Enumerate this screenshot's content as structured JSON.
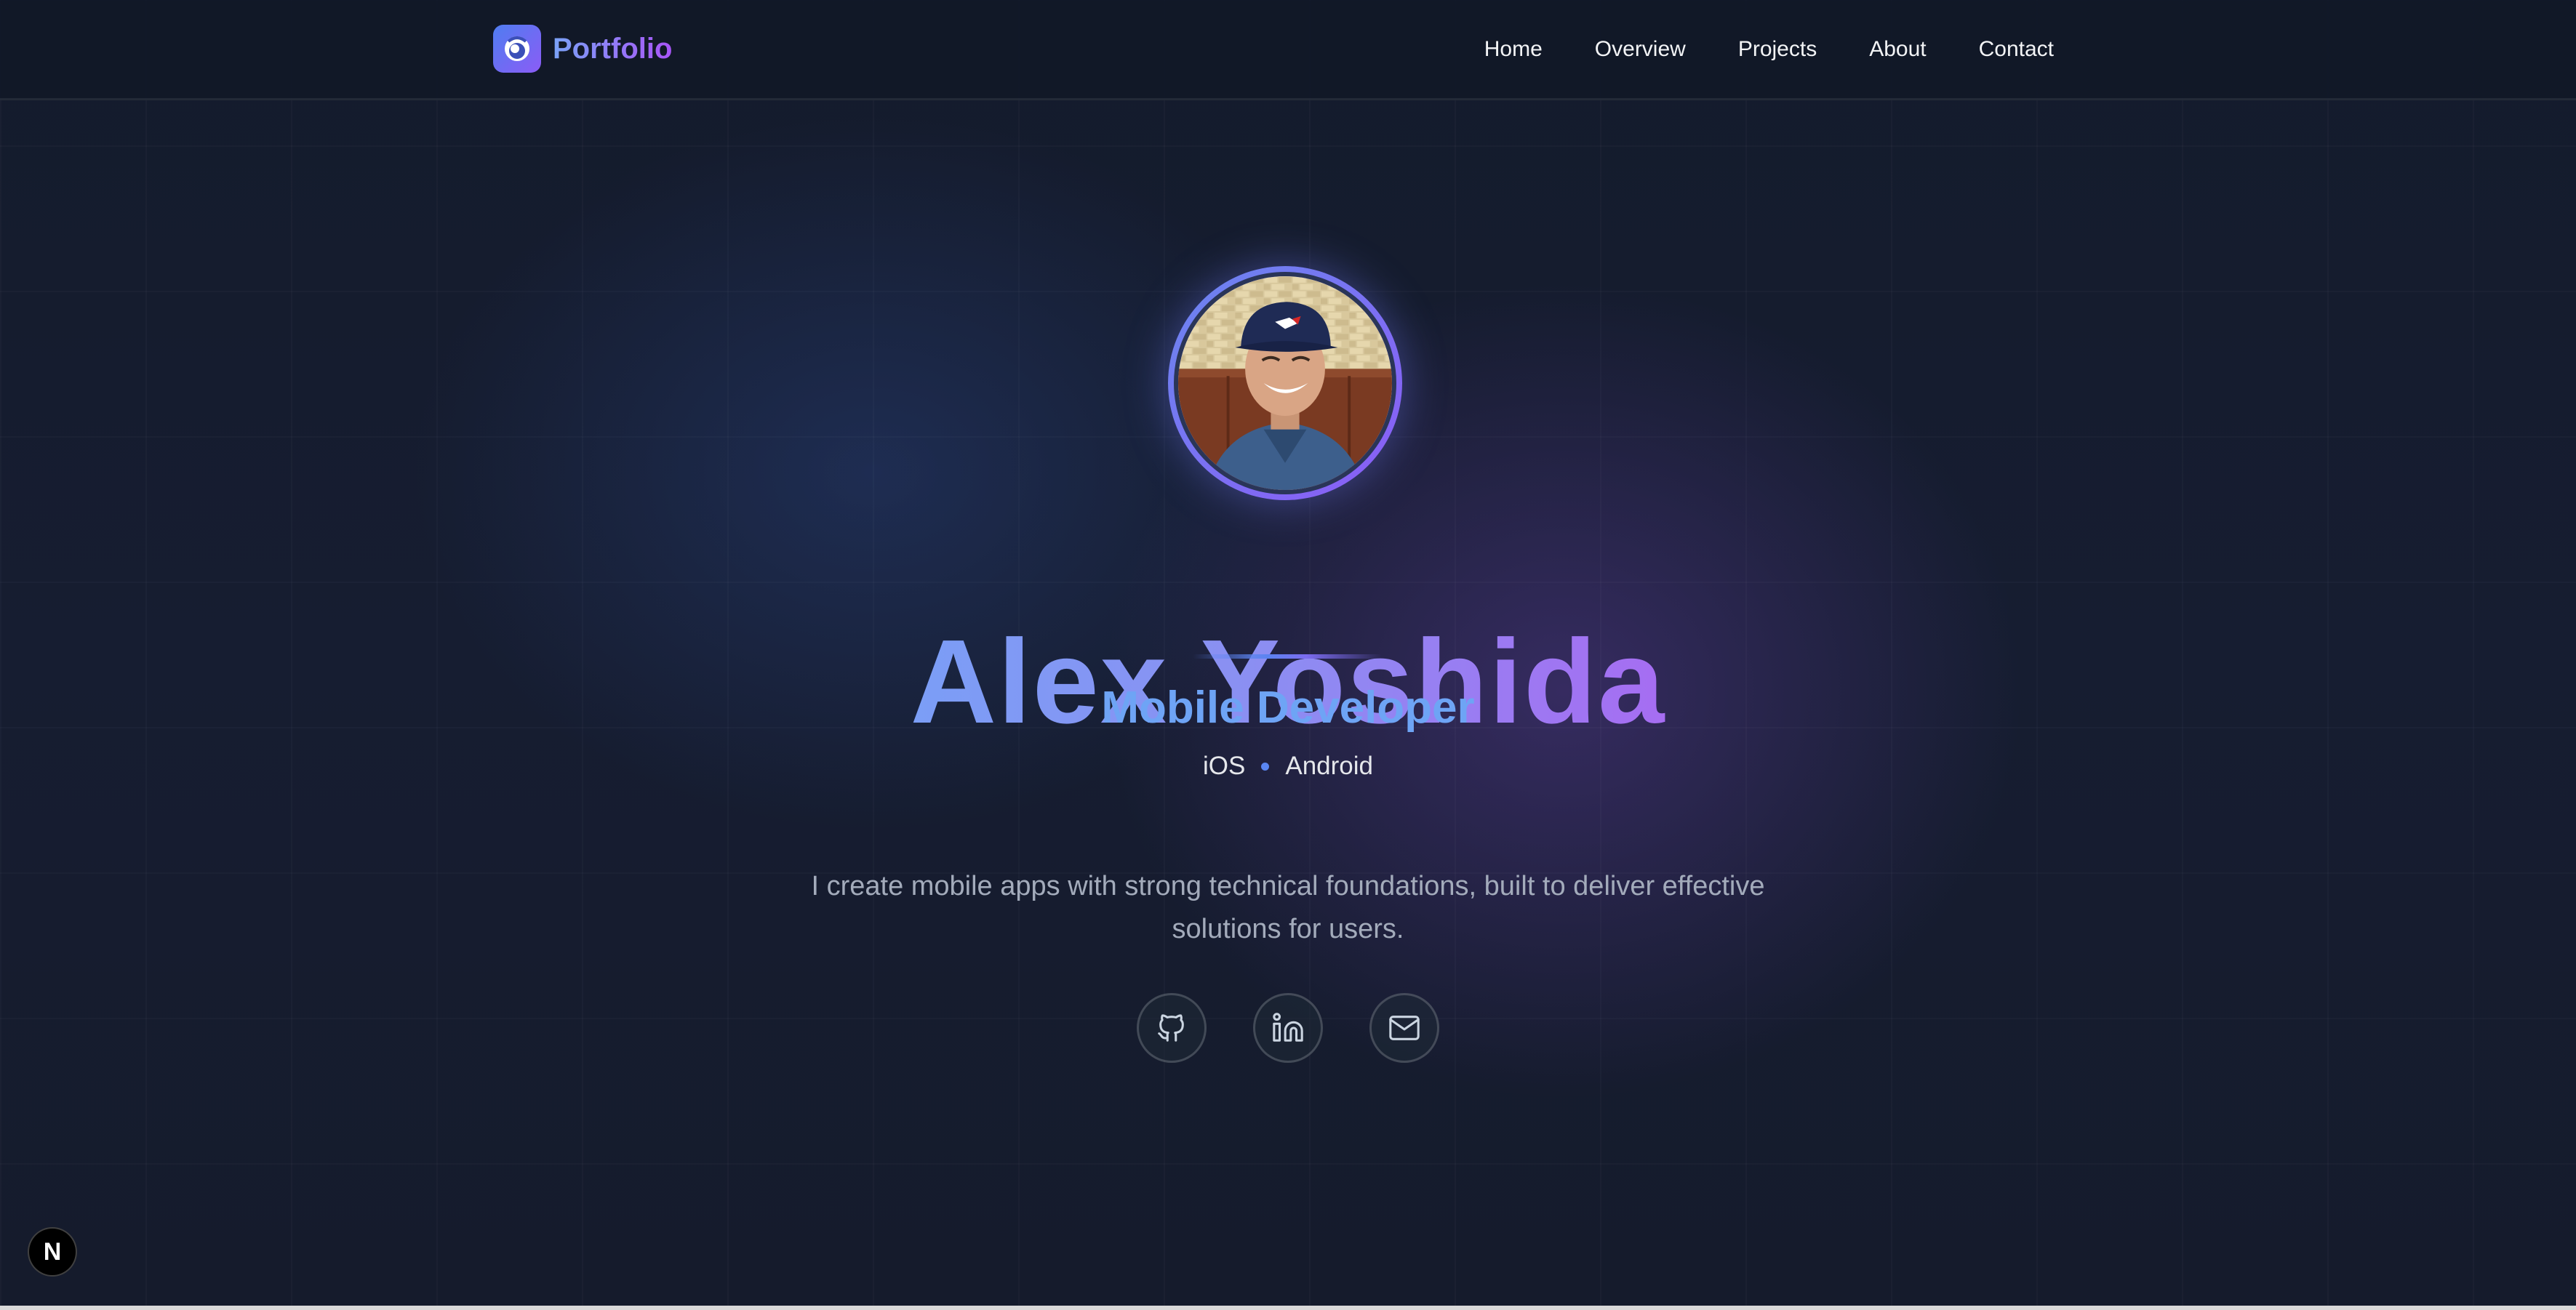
{
  "header": {
    "brand_name": "Portfolio",
    "nav": [
      "Home",
      "Overview",
      "Projects",
      "About",
      "Contact"
    ]
  },
  "hero": {
    "avatar_alt": "Profile photo",
    "name": "Alex Yoshida",
    "role": "Mobile Developer",
    "platforms": [
      "iOS",
      "Android"
    ],
    "bio": "I create mobile apps with strong technical foundations, built to deliver effective solutions for users.",
    "socials": [
      {
        "icon": "github-icon"
      },
      {
        "icon": "linkedin-icon"
      },
      {
        "icon": "mail-icon"
      }
    ]
  },
  "badge": {
    "label": "N"
  },
  "colors": {
    "background": "#141b2c",
    "accent_blue": "#6ea4f5",
    "accent_purple": "#a855f7",
    "text_muted": "#a3abbb"
  }
}
